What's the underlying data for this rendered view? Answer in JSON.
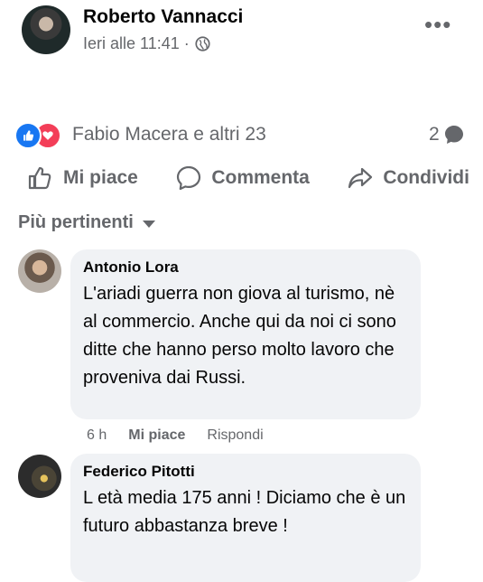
{
  "post": {
    "author": "Roberto Vannacci",
    "timestamp": "Ieri alle 11:41 ·",
    "privacy_icon": "globe-icon",
    "more_label": "•••"
  },
  "reactions": {
    "icons": [
      "like-icon",
      "love-icon"
    ],
    "summary": "Fabio Macera e altri 23",
    "comment_count": "2"
  },
  "actions": {
    "like": "Mi piace",
    "comment": "Commenta",
    "share": "Condividi"
  },
  "comments_sort": "Più pertinenti",
  "comments": [
    {
      "name": "Antonio Lora",
      "text": "L'ariadi guerra non giova al turismo, nè al commercio. Anche qui da noi ci sono ditte che hanno perso molto lavoro che proveniva dai Russi.",
      "time": "6 h",
      "like": "Mi piace",
      "reply": "Rispondi"
    },
    {
      "name": "Federico Pitotti",
      "text": "L età media 175 anni ! Diciamo che è un futuro abbastanza breve !"
    }
  ],
  "colors": {
    "secondary_text": "#65676b",
    "bubble_bg": "#f0f2f5",
    "like_blue": "#1877f2",
    "love_red": "#f33e58"
  }
}
